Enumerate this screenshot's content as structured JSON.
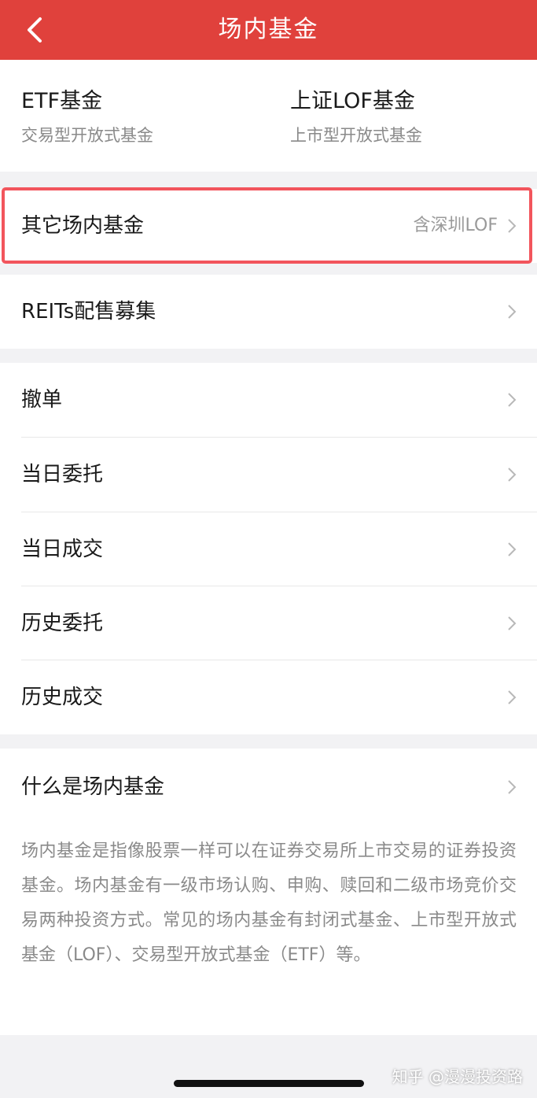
{
  "header": {
    "title": "场内基金",
    "back_icon": "chevron-left-icon"
  },
  "fund_types": [
    {
      "title": "ETF基金",
      "subtitle": "交易型开放式基金"
    },
    {
      "title": "上证LOF基金",
      "subtitle": "上市型开放式基金"
    }
  ],
  "other_fund": {
    "label": "其它场内基金",
    "hint": "含深圳LOF"
  },
  "reits": {
    "label": "REITs配售募集"
  },
  "order_menu": [
    {
      "label": "撤单"
    },
    {
      "label": "当日委托"
    },
    {
      "label": "当日成交"
    },
    {
      "label": "历史委托"
    },
    {
      "label": "历史成交"
    }
  ],
  "about": {
    "label": "什么是场内基金",
    "description": "场内基金是指像股票一样可以在证券交易所上市交易的证券投资基金。场内基金有一级市场认购、申购、赎回和二级市场竞价交易两种投资方式。常见的场内基金有封闭式基金、上市型开放式基金（LOF）、交易型开放式基金（ETF）等。"
  },
  "watermark": "知乎 @漫漫投资路",
  "colors": {
    "header_bg": "#e0413c",
    "highlight_border": "#f2555c",
    "page_bg": "#f2f2f4"
  }
}
